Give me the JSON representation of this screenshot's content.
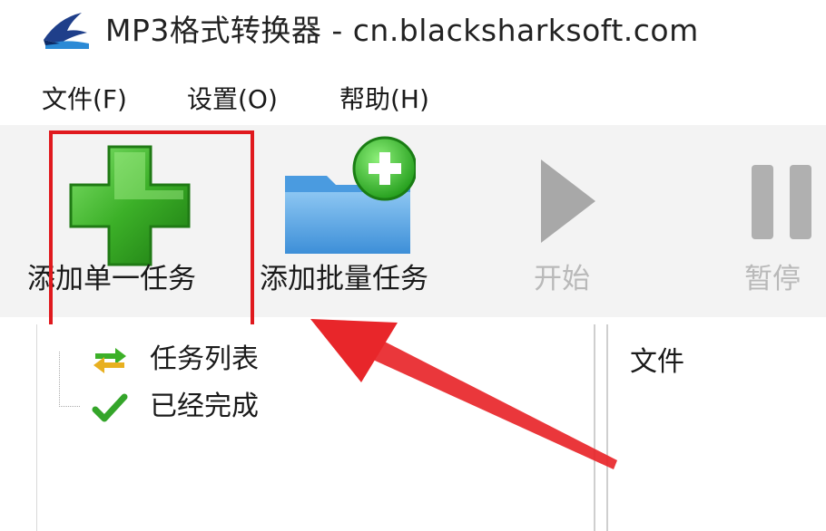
{
  "window": {
    "title": "MP3格式转换器 - cn.blacksharksoft.com",
    "icon": "blackshark-logo-icon"
  },
  "menu": {
    "items": [
      {
        "label": "文件(F)"
      },
      {
        "label": "设置(O)"
      },
      {
        "label": "帮助(H)"
      }
    ]
  },
  "toolbar": {
    "add_single": {
      "label": "添加单一任务",
      "icon": "green-plus-icon"
    },
    "add_batch": {
      "label": "添加批量任务",
      "icon": "folder-add-icon"
    },
    "start": {
      "label": "开始",
      "icon": "play-icon",
      "enabled": false
    },
    "pause": {
      "label": "暂停",
      "icon": "pause-icon",
      "enabled": false
    }
  },
  "task_tree": {
    "items": [
      {
        "label": "任务列表",
        "icon": "task-list-icon"
      },
      {
        "label": "已经完成",
        "icon": "checkmark-icon"
      }
    ]
  },
  "file_table": {
    "columns": [
      {
        "label": "文件"
      }
    ]
  },
  "colors": {
    "highlight": "#e0191e",
    "arrow": "#e8262a",
    "plus_green": "#3cb028",
    "folder_blue": "#5aa8e8"
  }
}
